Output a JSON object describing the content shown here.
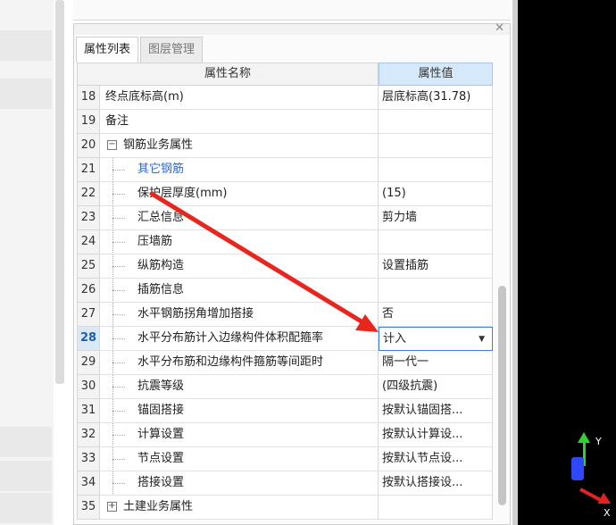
{
  "panel": {
    "tabs": [
      {
        "label": "属性列表",
        "active": true
      },
      {
        "label": "图层管理",
        "active": false
      }
    ],
    "close_icon": "close-icon"
  },
  "grid": {
    "header_name": "属性名称",
    "header_value": "属性值",
    "selected_row": "28",
    "rows": [
      {
        "num": "18",
        "name": "终点底标高(m)",
        "value": "层底标高(31.78)",
        "level": 0
      },
      {
        "num": "19",
        "name": "备注",
        "value": "",
        "level": 0
      },
      {
        "num": "20",
        "name": "钢筋业务属性",
        "value": "",
        "level": 0,
        "expander": "−"
      },
      {
        "num": "21",
        "name": "其它钢筋",
        "value": "",
        "level": 1,
        "link": true
      },
      {
        "num": "22",
        "name": "保护层厚度(mm)",
        "value": "(15)",
        "level": 1
      },
      {
        "num": "23",
        "name": "汇总信息",
        "value": "剪力墙",
        "level": 1
      },
      {
        "num": "24",
        "name": "压墙筋",
        "value": "",
        "level": 1
      },
      {
        "num": "25",
        "name": "纵筋构造",
        "value": "设置插筋",
        "level": 1
      },
      {
        "num": "26",
        "name": "插筋信息",
        "value": "",
        "level": 1
      },
      {
        "num": "27",
        "name": "水平钢筋拐角增加搭接",
        "value": "否",
        "level": 1
      },
      {
        "num": "28",
        "name": "水平分布筋计入边缘构件体积配箍率",
        "value": "计入",
        "level": 1,
        "editing": true
      },
      {
        "num": "29",
        "name": "水平分布筋和边缘构件箍筋等间距时",
        "value": "隔一代一",
        "level": 1
      },
      {
        "num": "30",
        "name": "抗震等级",
        "value": "(四级抗震)",
        "level": 1
      },
      {
        "num": "31",
        "name": "锚固搭接",
        "value": "按默认锚固搭...",
        "level": 1
      },
      {
        "num": "32",
        "name": "计算设置",
        "value": "按默认计算设...",
        "level": 1
      },
      {
        "num": "33",
        "name": "节点设置",
        "value": "按默认节点设...",
        "level": 1
      },
      {
        "num": "34",
        "name": "搭接设置",
        "value": "按默认搭接设...",
        "level": 1
      },
      {
        "num": "35",
        "name": "土建业务属性",
        "value": "",
        "level": 0,
        "expander": "+"
      }
    ]
  },
  "viewport": {
    "axis_y_label": "Y",
    "axis_x_label": "X",
    "colors": {
      "x": "#e52121",
      "y": "#2fd02f",
      "z": "#2e47ff"
    }
  },
  "annotation": {
    "color": "#e8261e"
  }
}
